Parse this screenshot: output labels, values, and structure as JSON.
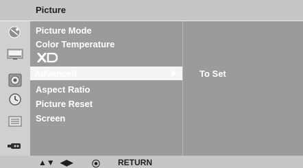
{
  "header": {
    "title": "Picture"
  },
  "menu": {
    "items": [
      {
        "label": "Picture Mode"
      },
      {
        "label": "Color Temperature"
      },
      {
        "label": "XD",
        "logo": true
      },
      {
        "label": "Advanced",
        "selected": true
      },
      {
        "label": "Aspect Ratio"
      },
      {
        "label": "Picture Reset"
      },
      {
        "label": "Screen"
      }
    ]
  },
  "submenu": {
    "value": "To Set"
  },
  "sidebar": {
    "icons": [
      "satellite-dish-icon",
      "picture-tv-icon",
      "audio-speaker-icon",
      "clock-icon",
      "options-box-icon",
      "input-plug-icon"
    ]
  },
  "footer": {
    "updown_glyph": "▲▼",
    "leftright_glyph": "◀▶",
    "ok_glyph": "⦿",
    "return_label": "RETURN"
  },
  "colors": {
    "menu_bg": "#9b9b9b",
    "frame_bg": "#c6c6c6",
    "sidebar_bg": "#d0d0d0",
    "selected_bg": "#f5f5f5",
    "text_light": "#ffffff",
    "text_dark": "#1f1f1f"
  }
}
